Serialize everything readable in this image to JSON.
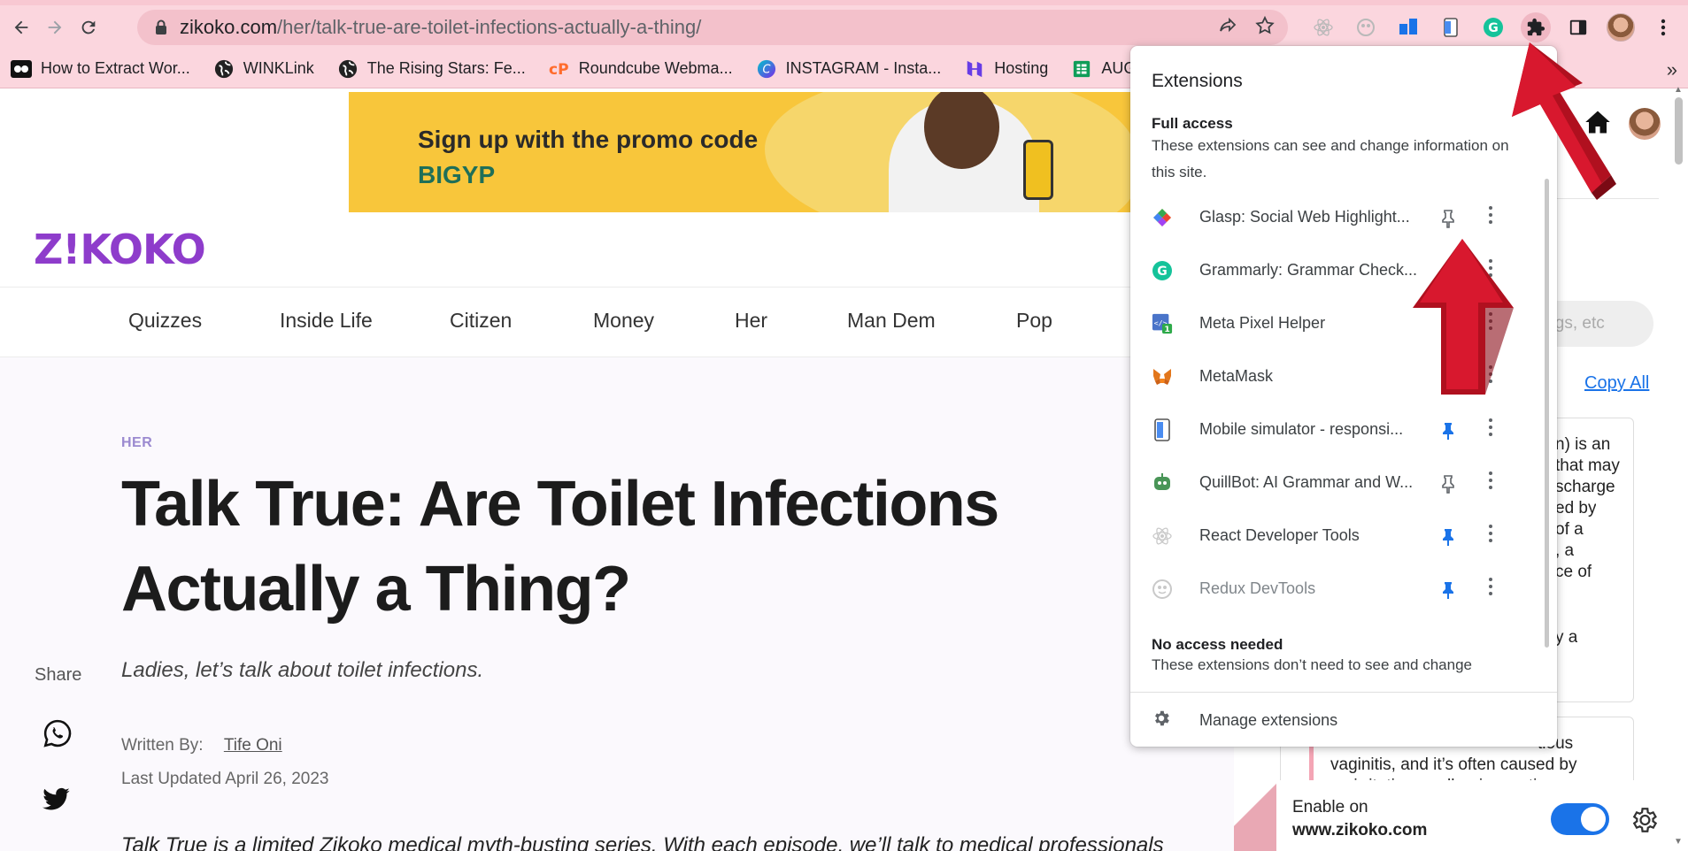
{
  "browser": {
    "url_host": "zikoko.com",
    "url_path": "/her/talk-true-are-toilet-infections-actually-a-thing/",
    "bookmarks": [
      {
        "label": "How to Extract Wor...",
        "icon": "media-icon"
      },
      {
        "label": "WINKLink",
        "icon": "globe-icon"
      },
      {
        "label": "The Rising Stars: Fe...",
        "icon": "globe-icon"
      },
      {
        "label": "Roundcube Webma...",
        "icon": "cpanel-icon"
      },
      {
        "label": "INSTAGRAM - Insta...",
        "icon": "canva-icon"
      },
      {
        "label": "Hosting",
        "icon": "hosting-icon"
      },
      {
        "label": "AUGUS",
        "icon": "sheets-icon"
      }
    ],
    "bookmarks_overflow": "»"
  },
  "banner": {
    "line1": "Sign up with the promo code",
    "line2": "BIGYP"
  },
  "site": {
    "logo": "Z!KOKO",
    "menu": [
      "Quizzes",
      "Inside Life",
      "Citizen",
      "Money",
      "Her",
      "Man Dem",
      "Pop"
    ]
  },
  "article": {
    "kicker": "HER",
    "title_line1": "Talk True: Are Toilet Infections",
    "title_line2": "Actually a Thing?",
    "subtitle": "Ladies, let’s talk about toilet infections.",
    "share_label": "Share",
    "written_by_label": "Written By:",
    "author": "Tife Oni",
    "updated": "Last Updated April 26, 2023",
    "intro": "Talk True is a limited Zikoko medical myth-busting series. With each episode, we’ll talk to medical professionals"
  },
  "sidebar": {
    "search_placeholder": "ings, etc",
    "copy_all": "Copy All",
    "card1_lines": [
      "n) is an",
      "that may",
      "scharge",
      "ed by",
      "of a",
      ", a",
      "ce of",
      "",
      "",
      "y a"
    ],
    "card2_lines": [
      "                     tious",
      "vaginitis, and it’s often caused by",
      "an irritation or allergic reaction"
    ],
    "enable_label": "Enable on",
    "enable_site": "www.zikoko.com"
  },
  "extensions_popup": {
    "title": "Extensions",
    "full_access_title": "Full access",
    "full_access_desc": "These extensions can see and change information on this site.",
    "items": [
      {
        "name": "Glasp: Social Web Highlight...",
        "icon": "glasp-icon",
        "pinned": false
      },
      {
        "name": "Grammarly: Grammar Check...",
        "icon": "grammarly-icon",
        "pinned": false
      },
      {
        "name": "Meta Pixel Helper",
        "icon": "meta-pixel-icon",
        "pinned": false
      },
      {
        "name": "MetaMask",
        "icon": "metamask-fox-icon",
        "pinned": false
      },
      {
        "name": "Mobile simulator - responsi...",
        "icon": "mobile-simulator-icon",
        "pinned": true
      },
      {
        "name": "QuillBot: AI Grammar and W...",
        "icon": "quillbot-icon",
        "pinned": false
      },
      {
        "name": "React Developer Tools",
        "icon": "react-icon",
        "pinned": true
      },
      {
        "name": "Redux DevTools",
        "icon": "redux-icon",
        "pinned": true
      }
    ],
    "no_access_title": "No access needed",
    "no_access_desc": "These extensions don’t need to see and change",
    "manage_label": "Manage extensions"
  },
  "colors": {
    "chrome_bg": "#fbd6de",
    "logo": "#8e3ccb",
    "pin_active": "#1a73e8",
    "arrow_red": "#c8102e"
  }
}
